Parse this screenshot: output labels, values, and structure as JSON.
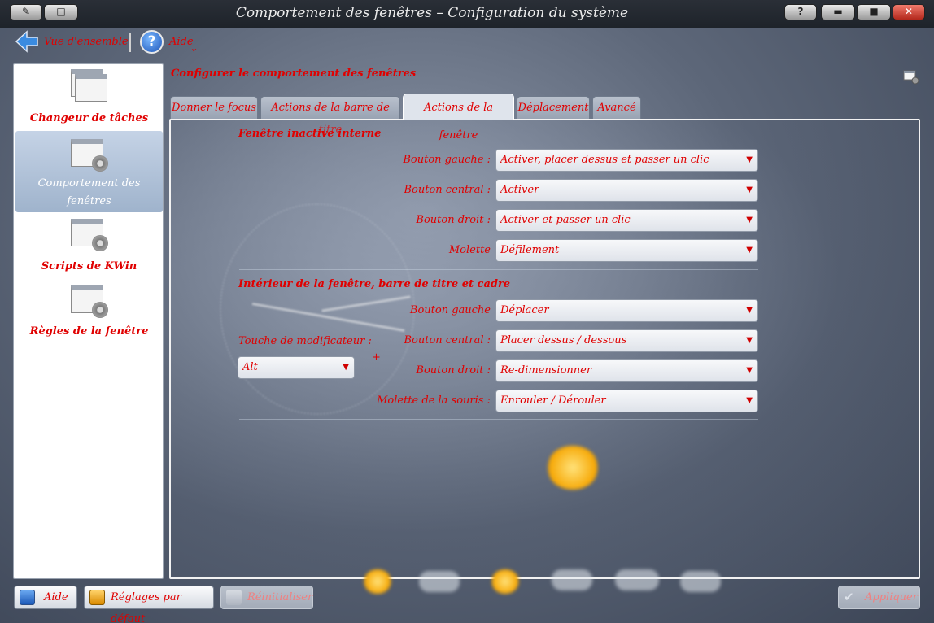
{
  "window": {
    "title": "Comportement des fenêtres – Configuration du système",
    "controls": {
      "help": "?",
      "minimize": "▬",
      "maximize": "■",
      "close": "✕"
    }
  },
  "toolbar": {
    "back_label": "Vue d'ensemble",
    "help_label": "Aide",
    "help_menu_arrow": "⌄"
  },
  "sidebar": {
    "items": [
      {
        "label": "Changeur de tâches",
        "icon": "windows-stack-icon",
        "selected": false
      },
      {
        "label": "Comportement des fenêtres",
        "icon": "window-gear-icon",
        "selected": true
      },
      {
        "label": "Scripts de KWin",
        "icon": "window-gear-icon",
        "selected": false
      },
      {
        "label": "Règles de la fenêtre",
        "icon": "window-gear-icon",
        "selected": false
      }
    ]
  },
  "main": {
    "heading": "Configurer le comportement des fenêtres",
    "tabs": [
      {
        "label": "Donner le focus",
        "active": false
      },
      {
        "label": "Actions de la barre de titre",
        "active": false
      },
      {
        "label": "Actions de la fenêtre",
        "active": true
      },
      {
        "label": "Déplacement",
        "active": false
      },
      {
        "label": "Avancé",
        "active": false
      }
    ],
    "inactive_section": {
      "title": "Fenêtre inactive interne",
      "rows": [
        {
          "label": "Bouton gauche :",
          "value": "Activer, placer dessus et passer un clic"
        },
        {
          "label": "Bouton central :",
          "value": "Activer"
        },
        {
          "label": "Bouton droit :",
          "value": "Activer et passer un clic"
        },
        {
          "label": "Molette",
          "value": "Défilement"
        }
      ]
    },
    "inner_section": {
      "title": "Intérieur de la fenêtre, barre de titre et cadre",
      "modifier_label": "Touche de modificateur :",
      "modifier_value": "Alt",
      "plus": "+",
      "rows": [
        {
          "label": "Bouton gauche",
          "value": "Déplacer"
        },
        {
          "label": "Bouton central :",
          "value": "Placer dessus / dessous"
        },
        {
          "label": "Bouton droit :",
          "value": "Re-dimensionner"
        },
        {
          "label": "Molette de la souris :",
          "value": "Enrouler / Dérouler"
        }
      ]
    }
  },
  "footer": {
    "help": "Aide",
    "defaults": "Réglages par défaut",
    "reset": "Réinitialiser",
    "apply": "Appliquer"
  },
  "colors": {
    "label_red": "#e00000",
    "selected_item": "#a9bbd2",
    "title_bar": "#23282f"
  }
}
